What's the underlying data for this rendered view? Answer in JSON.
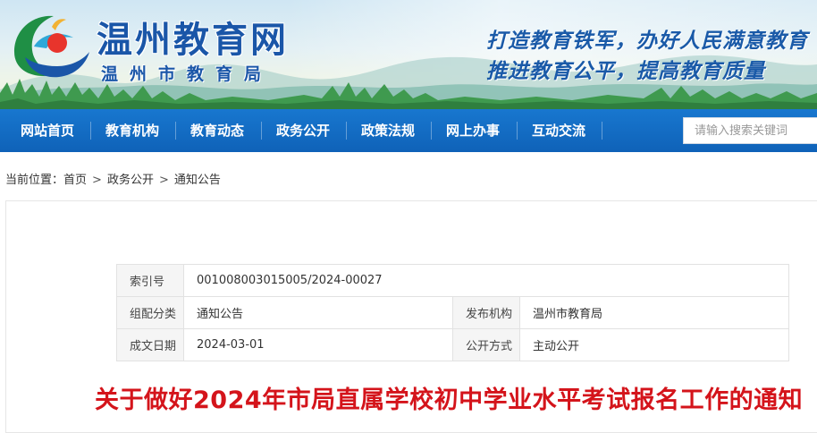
{
  "header": {
    "site_title": "温州教育网",
    "site_subtitle": "温州市教育局",
    "slogan_line1": "打造教育铁军，办好人民满意教育",
    "slogan_line2": "推进教育公平，提高教育质量",
    "logo_icon": "wenzhou-education-logo",
    "colors": {
      "brand_blue": "#1a56a8",
      "nav_blue": "#1470c8",
      "title_red": "#d4141b"
    }
  },
  "nav": {
    "items": [
      {
        "label": "网站首页"
      },
      {
        "label": "教育机构"
      },
      {
        "label": "教育动态"
      },
      {
        "label": "政务公开"
      },
      {
        "label": "政策法规"
      },
      {
        "label": "网上办事"
      },
      {
        "label": "互动交流"
      }
    ],
    "search_placeholder": "请输入搜索关键词"
  },
  "breadcrumb": {
    "prefix": "当前位置：",
    "items": [
      "首页",
      "政务公开",
      "通知公告"
    ],
    "separator": ">"
  },
  "meta": {
    "index_label": "索引号",
    "index_value": "001008003015005/2024-00027",
    "category_label": "组配分类",
    "category_value": "通知公告",
    "publisher_label": "发布机构",
    "publisher_value": "温州市教育局",
    "date_label": "成文日期",
    "date_value": "2024-03-01",
    "disclosure_label": "公开方式",
    "disclosure_value": "主动公开"
  },
  "article": {
    "title": "关于做好2024年市局直属学校初中学业水平考试报名工作的通知"
  }
}
